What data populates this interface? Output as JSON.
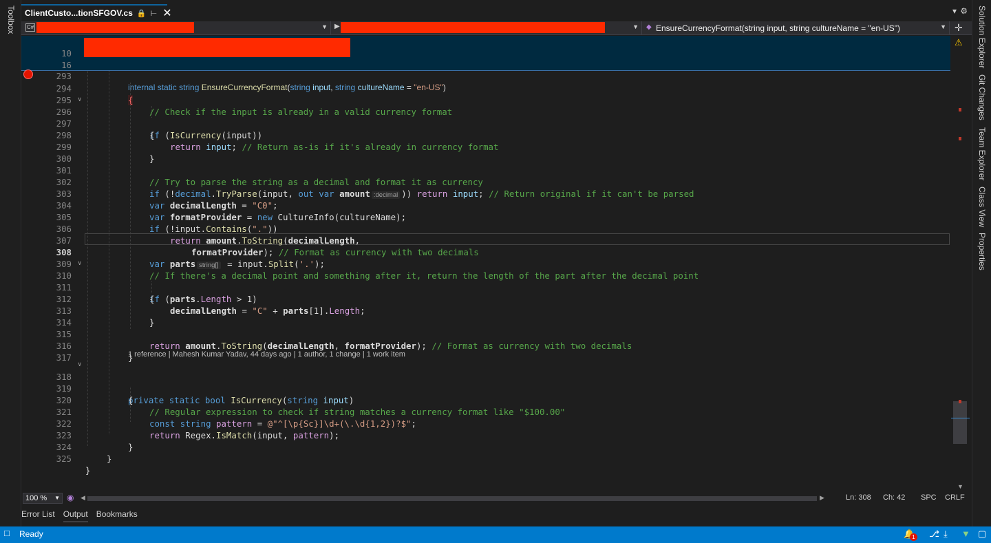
{
  "left_rail": {
    "toolbox_label": "Toolbox"
  },
  "right_rail": {
    "panels": [
      "Solution Explorer",
      "Git Changes",
      "Team Explorer",
      "Class View",
      "Properties"
    ]
  },
  "tab": {
    "title": "ClientCusto...tionSFGOV.cs",
    "lock_icon": "lock-icon",
    "pin_icon": "pin-icon",
    "close_glyph": "✕"
  },
  "tabbar_controls": {
    "dropdown_glyph": "▾",
    "settings_glyph": "⚙"
  },
  "navbar": {
    "project_icon": "C#",
    "member_selected": "EnsureCurrencyFormat(string input, string cultureName = \"en-US\")",
    "split_glyph": "✛"
  },
  "sticky_lines": [
    {
      "number": "10"
    },
    {
      "number": "16"
    },
    {
      "number": "293"
    }
  ],
  "sticky_code_293": {
    "internal": "internal",
    "static": "static",
    "string": "string",
    "method": "EnsureCurrencyFormat",
    "open": "(",
    "string2": "string",
    "input": "input",
    "comma": ",",
    "string3": "string",
    "culture": "cultureName",
    "eq": " = ",
    "default": "\"en-US\"",
    "close": ")"
  },
  "line_numbers": [
    "294",
    "295",
    "296",
    "297",
    "298",
    "299",
    "300",
    "301",
    "302",
    "303",
    "304",
    "305",
    "306",
    "307",
    "308",
    "309",
    "310",
    "311",
    "312",
    "313",
    "314",
    "315",
    "316",
    "317",
    "318",
    "319",
    "320",
    "321",
    "322",
    "323",
    "324",
    "325"
  ],
  "code": {
    "l294": "{",
    "l295": "// Check if the input is already in a valid currency format",
    "l296_if": "if",
    "l296_rest_open": " (",
    "l296_call": "IsCurrency",
    "l296_args": "(input)",
    "l296_close": ")",
    "l297": "{",
    "l298_return": "return",
    "l298_input": "input",
    "l298_semi": ";",
    "l298_comment": "// Return as-is if it's already in currency format",
    "l299": "}",
    "l301": "// Try to parse the string as a decimal and format it as currency",
    "l302_if": "if",
    "l302_a": " (!",
    "l302_decimal": "decimal",
    "l302_dot": ".",
    "l302_tryparse": "TryParse",
    "l302_b": "(input, ",
    "l302_out": "out",
    "l302_var": "var",
    "l302_amount": "amount",
    "l302_hint": ":decimal",
    "l302_c": ")) ",
    "l302_return": "return",
    "l302_input": "input",
    "l302_d": "; ",
    "l302_comment": "// Return original if it can't be parsed",
    "l303_var": "var",
    "l303_name": "decimalLength",
    "l303_eq": " = ",
    "l303_val": "\"C0\"",
    "l303_semi": ";",
    "l304_var": "var",
    "l304_name": "formatProvider",
    "l304_eq": " = ",
    "l304_new": "new",
    "l304_type": "CultureInfo",
    "l304_args": "(cultureName);",
    "l305_if": "if",
    "l305_a": " (!input.",
    "l305_contains": "Contains",
    "l305_b": "(",
    "l305_str": "\".\"",
    "l305_c": "))",
    "l306_return": "return",
    "l306_amount": "amount",
    "l306_dot": ".",
    "l306_tostring": "ToString",
    "l306_open": "(",
    "l306_arg": "decimalLength",
    "l306_comma": ",",
    "l307_arg": "formatProvider",
    "l307_close": ");",
    "l307_comment": "// Format as currency with two decimals",
    "l308_var": "var",
    "l308_name": "parts",
    "l308_hint": "string[]",
    "l308_eq": " = input.",
    "l308_split": "Split",
    "l308_open": "(",
    "l308_char": "'.'",
    "l308_close": ");",
    "l309": "// If there's a decimal point and something after it, return the length of the part after the decimal point",
    "l310_if": "if",
    "l310_a": " (",
    "l310_parts": "parts",
    "l310_dot": ".",
    "l310_length": "Length",
    "l310_b": " > 1)",
    "l311": "{",
    "l312_name": "decimalLength",
    "l312_eq": " = ",
    "l312_str": "\"C\"",
    "l312_plus": " + ",
    "l312_parts": "parts",
    "l312_idx": "[1].",
    "l312_length": "Length",
    "l312_semi": ";",
    "l313": "}",
    "l315_return": "return",
    "l315_amount": "amount",
    "l315_dot": ".",
    "l315_tostring": "ToString",
    "l315_open": "(",
    "l315_arg1": "decimalLength",
    "l315_comma": ", ",
    "l315_arg2": "formatProvider",
    "l315_close": ");",
    "l315_comment": "// Format as currency with two decimals",
    "l316": "}",
    "codelens": "1 reference | Mahesh Kumar Yadav, 44 days ago | 1 author, 1 change | 1 work item",
    "l318_private": "private",
    "l318_static": "static",
    "l318_bool": "bool",
    "l318_name": "IsCurrency",
    "l318_open": "(",
    "l318_string": "string",
    "l318_input": "input",
    "l318_close": ")",
    "l319": "{",
    "l320": "// Regular expression to check if string matches a currency format like \"$100.00\"",
    "l321_const": "const",
    "l321_string": "string",
    "l321_name": "pattern",
    "l321_eq": " = ",
    "l321_val": "@\"^[\\p{Sc}]\\d+(\\.\\d{1,2})?$\"",
    "l321_semi": ";",
    "l322_return": "return",
    "l322_regex": "Regex",
    "l322_dot": ".",
    "l322_ismatch": "IsMatch",
    "l322_args": "(input, ",
    "l322_pattern": "pattern",
    "l322_close": ");",
    "l323": "}",
    "l324": "}",
    "l325": "}"
  },
  "editor_status": {
    "zoom": "100 %",
    "line": "Ln: 308",
    "col": "Ch: 42",
    "spc": "SPC",
    "eol": "CRLF"
  },
  "tool_tabs": [
    "Error List",
    "Output",
    "Bookmarks"
  ],
  "status": {
    "text": "Ready",
    "notification_count": "1"
  },
  "colors": {
    "accent": "#007acc",
    "editor_bg": "#1e1e1e",
    "breakpoint": "#e51400",
    "redaction": "#ff2a00"
  }
}
